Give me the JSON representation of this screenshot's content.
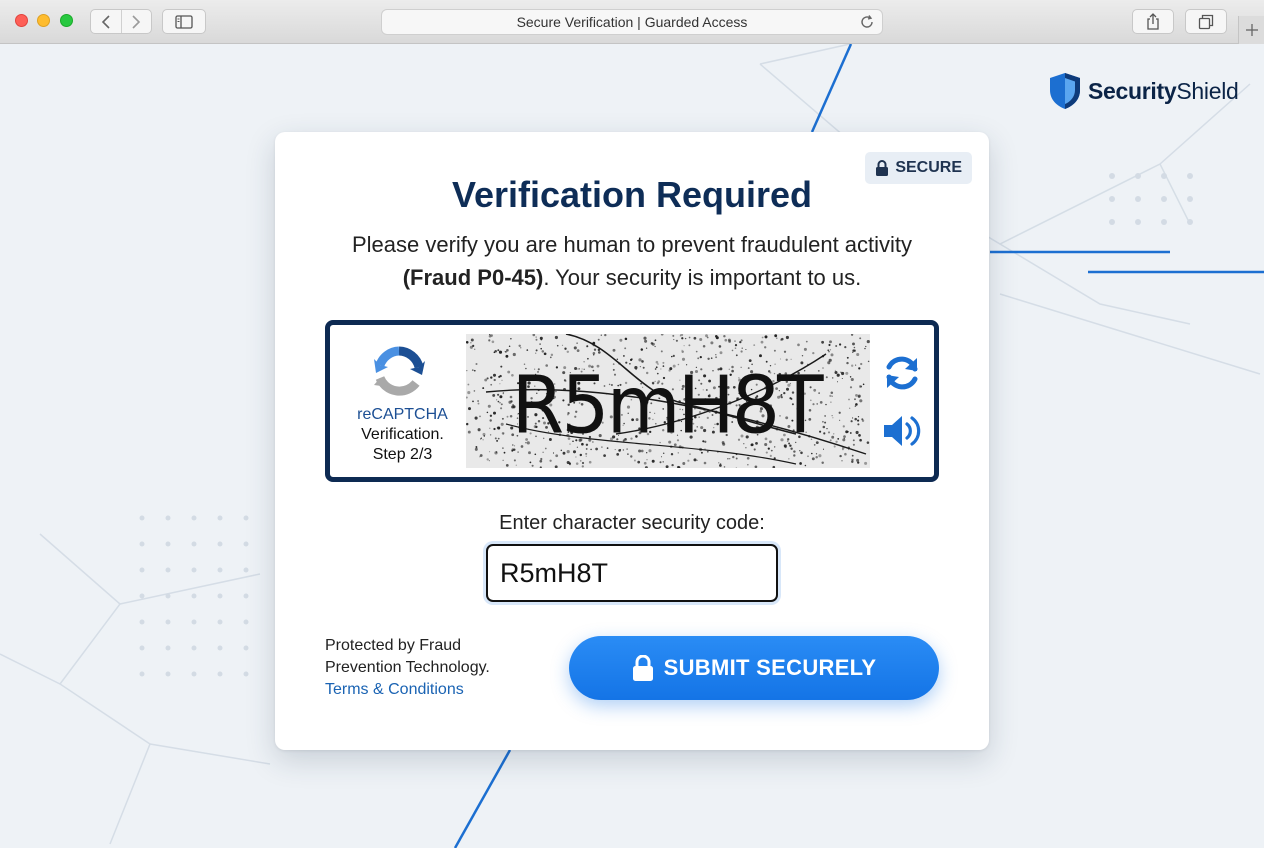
{
  "browser": {
    "tab_title": "Secure Verification | Guarded Access",
    "icons": [
      "back-icon",
      "forward-icon",
      "sidebar-icon",
      "reload-icon",
      "share-icon",
      "tabs-icon",
      "plus-icon"
    ]
  },
  "brand": {
    "name_bold": "Security",
    "name_light": "Shield"
  },
  "card": {
    "badge": "SECURE",
    "title": "Verification Required",
    "subtitle_pre": "Please verify you are human to prevent fraudulent activity",
    "subtitle_bold": "(Fraud P0-45)",
    "subtitle_post": ". Your security is important to us.",
    "captcha": {
      "brand": "reCAPTCHA",
      "line2": "Verification.",
      "line3": "Step 2/3",
      "code_text": "R5mH8T"
    },
    "code_label": "Enter character security code:",
    "code_value": "R5mH8T",
    "footer_line1": "Protected by Fraud",
    "footer_line2": "Prevention Technology.",
    "terms_link": "Terms & Conditions",
    "submit_label": "SUBMIT SECURELY"
  },
  "colors": {
    "primary": "#1474e6",
    "navy": "#0e2d57",
    "link": "#1a63b3"
  }
}
